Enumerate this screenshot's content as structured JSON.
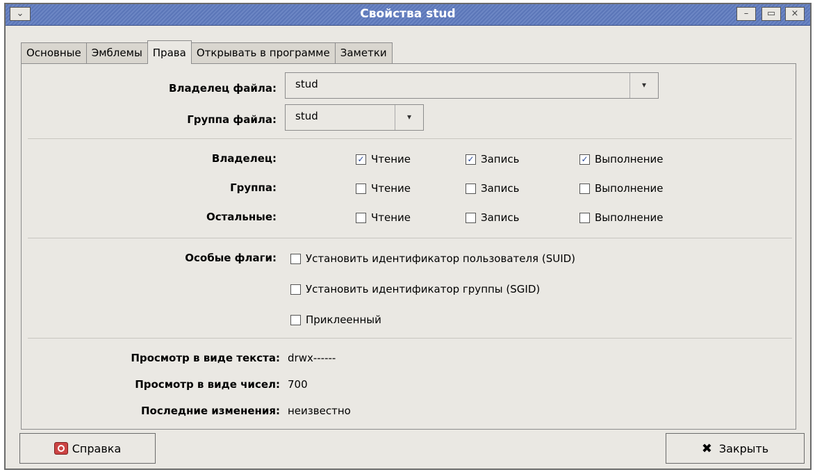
{
  "window": {
    "title": "Свойства stud",
    "menu_btn": "⌄",
    "min_btn": "–",
    "max_btn": "▭",
    "close_btn": "×"
  },
  "tabs": [
    {
      "label": "Основные",
      "active": false
    },
    {
      "label": "Эмблемы",
      "active": false
    },
    {
      "label": "Права",
      "active": true
    },
    {
      "label": "Открывать в программе",
      "active": false
    },
    {
      "label": "Заметки",
      "active": false
    }
  ],
  "ownership": {
    "owner_label": "Владелец файла:",
    "owner_value": "stud",
    "group_label": "Группа файла:",
    "group_value": "stud",
    "arrow": "▾"
  },
  "permissions": {
    "read": "Чтение",
    "write": "Запись",
    "exec": "Выполнение",
    "check_mark": "✓",
    "rows": [
      {
        "label": "Владелец:",
        "read": true,
        "write": true,
        "exec": true
      },
      {
        "label": "Группа:",
        "read": false,
        "write": false,
        "exec": false
      },
      {
        "label": "Остальные:",
        "read": false,
        "write": false,
        "exec": false
      }
    ]
  },
  "special": {
    "label": "Особые флаги:",
    "suid": "Установить идентификатор пользователя (SUID)",
    "sgid": "Установить идентификатор группы (SGID)",
    "sticky": "Приклеенный"
  },
  "info": {
    "text_view_label": "Просмотр в виде текста:",
    "text_view_value": "drwx------",
    "num_view_label": "Просмотр в виде чисел:",
    "num_view_value": "700",
    "last_change_label": "Последние изменения:",
    "last_change_value": "неизвестно"
  },
  "buttons": {
    "help": "Справка",
    "close": "Закрыть",
    "close_glyph": "✖"
  }
}
